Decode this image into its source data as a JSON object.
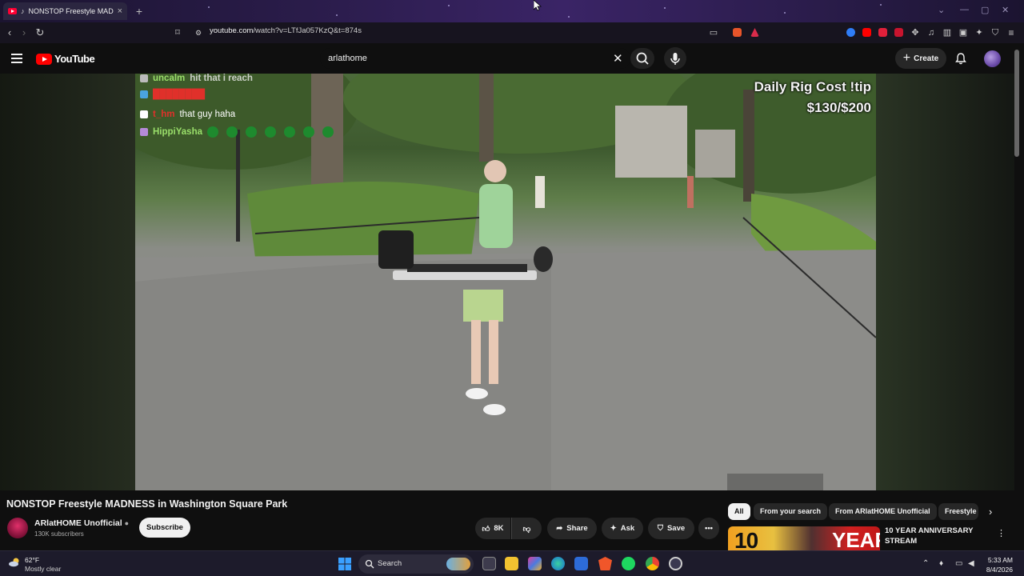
{
  "browser": {
    "tab_title": "NONSTOP Freestyle MADNESS",
    "tab_close": "×",
    "new_tab": "+",
    "url_host": "youtube.com",
    "url_path": "/watch?v=LTfJa057KzQ&t=874s"
  },
  "youtube": {
    "logo_text": "YouTube",
    "search_value": "arlathome",
    "create_label": "Create"
  },
  "video_overlay": {
    "chat": [
      {
        "user": "uncalm",
        "message": "hit that i reach",
        "color": "#9adf6a"
      },
      {
        "user": "████████",
        "message": "",
        "color": "#e0302a"
      },
      {
        "user": "t_hm",
        "message": "that guy haha",
        "color": "#e0302a"
      },
      {
        "user": "HippiYasha",
        "message": "",
        "color": "#9adf6a"
      }
    ],
    "rig_cost_title": "Daily Rig Cost !tip",
    "rig_cost_value": "$130/$200"
  },
  "watch": {
    "title": "NONSTOP Freestyle MADNESS in Washington Square Park",
    "channel_name": "ARlatHOME Unofficial",
    "subscribers": "130K subscribers",
    "subscribe_label": "Subscribe",
    "likes": "8K",
    "share_label": "Share",
    "ask_label": "Ask",
    "save_label": "Save"
  },
  "chips": [
    "All",
    "From your search",
    "From ARlatHOME Unofficial",
    "Freestyle"
  ],
  "recommendation": {
    "thumb_left": "10",
    "thumb_right": "YEAR",
    "title": "10 YEAR ANNIVERSARY STREAM"
  },
  "taskbar": {
    "temperature": "62°F",
    "weather": "Mostly clear",
    "search_label": "Search",
    "time": "5:33 AM",
    "date": "8/4/2026"
  },
  "colors": {
    "accent_red": "#ff0000",
    "background": "#0f0f0f",
    "chip_bg": "#272727"
  }
}
